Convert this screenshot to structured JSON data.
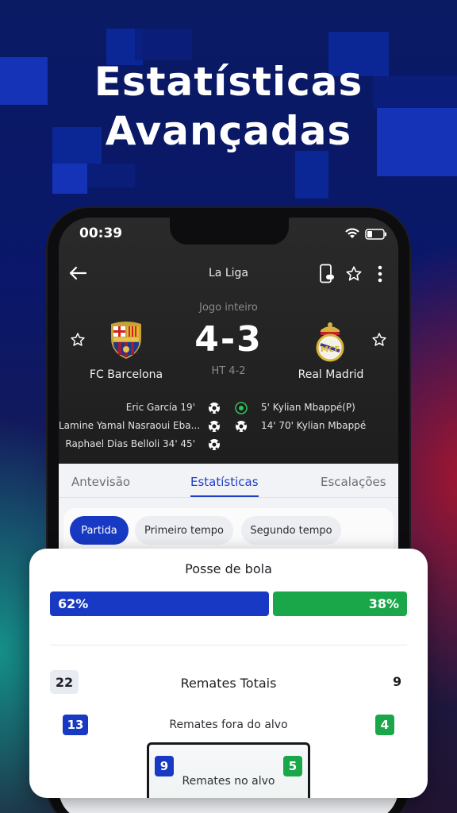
{
  "hero": {
    "line1": "Estatísticas",
    "line2": "Avançadas"
  },
  "status_bar": {
    "time": "00:39",
    "icons": [
      "wifi-icon",
      "battery-icon"
    ]
  },
  "match_header": {
    "league": "La Liga",
    "period": "Jogo inteiro",
    "score": "4-3",
    "halftime": "HT 4-2",
    "home_team": {
      "name": "FC Barcelona",
      "crest": "barcelona-crest-icon"
    },
    "away_team": {
      "name": "Real Madrid",
      "crest": "real-madrid-crest-icon"
    }
  },
  "events": {
    "home": [
      "Eric García 19'",
      "Lamine Yamal Nasraoui Eba...",
      "Raphael Dias Belloli 34' 45'"
    ],
    "away": [
      "5' Kylian Mbappé(P)",
      "14' 70' Kylian Mbappé"
    ]
  },
  "tabs": [
    {
      "label": "Antevisão",
      "active": false
    },
    {
      "label": "Estatísticas",
      "active": true
    },
    {
      "label": "Escalações",
      "active": false
    }
  ],
  "period_filters": [
    {
      "label": "Partida",
      "active": true
    },
    {
      "label": "Primeiro tempo",
      "active": false
    },
    {
      "label": "Segundo tempo",
      "active": false
    }
  ],
  "stats_card": {
    "possession": {
      "title": "Posse de bola",
      "home_pct": 62,
      "away_pct": 38,
      "home_label": "62%",
      "away_label": "38%"
    },
    "total_shots": {
      "title": "Remates Totais",
      "home": "22",
      "away": "9"
    },
    "shots_off_target": {
      "title": "Remates fora do alvo",
      "home": "13",
      "away": "4"
    },
    "shots_on_target": {
      "title": "Remates no alvo",
      "home": "9",
      "away": "5"
    }
  },
  "colors": {
    "home": "#1739c3",
    "away": "#1aa74a",
    "accent": "#1e3fc6"
  }
}
